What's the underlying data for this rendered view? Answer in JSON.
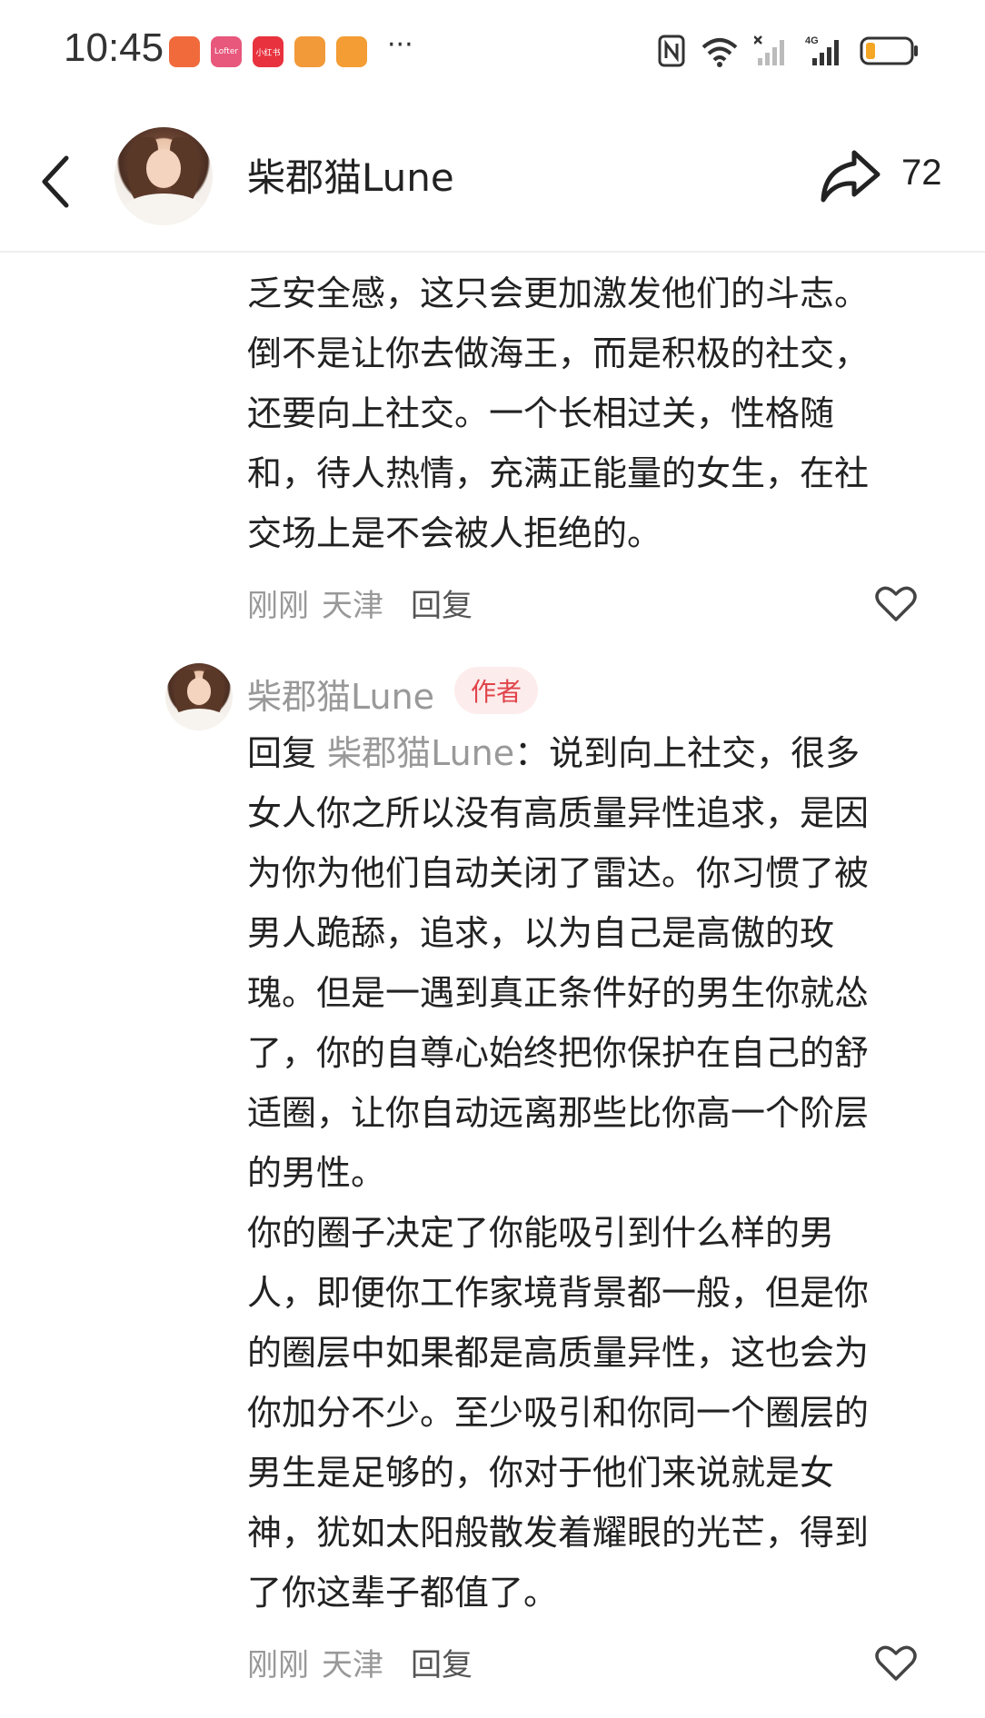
{
  "status_bar": {
    "time": "10:45",
    "more": "···",
    "app_icons": [
      {
        "name": "app-icon-1",
        "label": "",
        "color": "#f06a3c"
      },
      {
        "name": "app-icon-2",
        "label": "Lofter",
        "color": "#e8577c"
      },
      {
        "name": "app-icon-3",
        "label": "小红书",
        "color": "#e8323e"
      },
      {
        "name": "app-icon-4",
        "label": "",
        "color": "#f29a3a"
      },
      {
        "name": "app-icon-5",
        "label": "",
        "color": "#f39d34"
      }
    ],
    "battery_color": "#f5a623"
  },
  "header": {
    "name": "柴郡猫Lune",
    "share_count": "72"
  },
  "comment1": {
    "text": "乏安全感，这只会更加激发他们的斗志。\n倒不是让你去做海王，而是积极的社交，\n还要向上社交。一个长相过关，性格随\n和，待人热情，充满正能量的女生，在社\n交场上是不会被人拒绝的。",
    "time": "刚刚",
    "location": "天津",
    "reply_label": "回复"
  },
  "reply": {
    "name": "柴郡猫Lune",
    "badge": "作者",
    "prefix": "回复 ",
    "target": "柴郡猫Lune",
    "text": "：说到向上社交，很多\n女人你之所以没有高质量异性追求，是因\n为你为他们自动关闭了雷达。你习惯了被\n男人跪舔，追求，以为自己是高傲的玫\n瑰。但是一遇到真正条件好的男生你就怂\n了，你的自尊心始终把你保护在自己的舒\n适圈，让你自动远离那些比你高一个阶层\n的男性。\n你的圈子决定了你能吸引到什么样的男\n人，即便你工作家境背景都一般，但是你\n的圈层中如果都是高质量异性，这也会为\n你加分不少。至少吸引和你同一个圈层的\n男生是足够的，你对于他们来说就是女\n神，犹如太阳般散发着耀眼的光芒，得到\n了你这辈子都值了。",
    "time": "刚刚",
    "location": "天津",
    "reply_label": "回复"
  }
}
